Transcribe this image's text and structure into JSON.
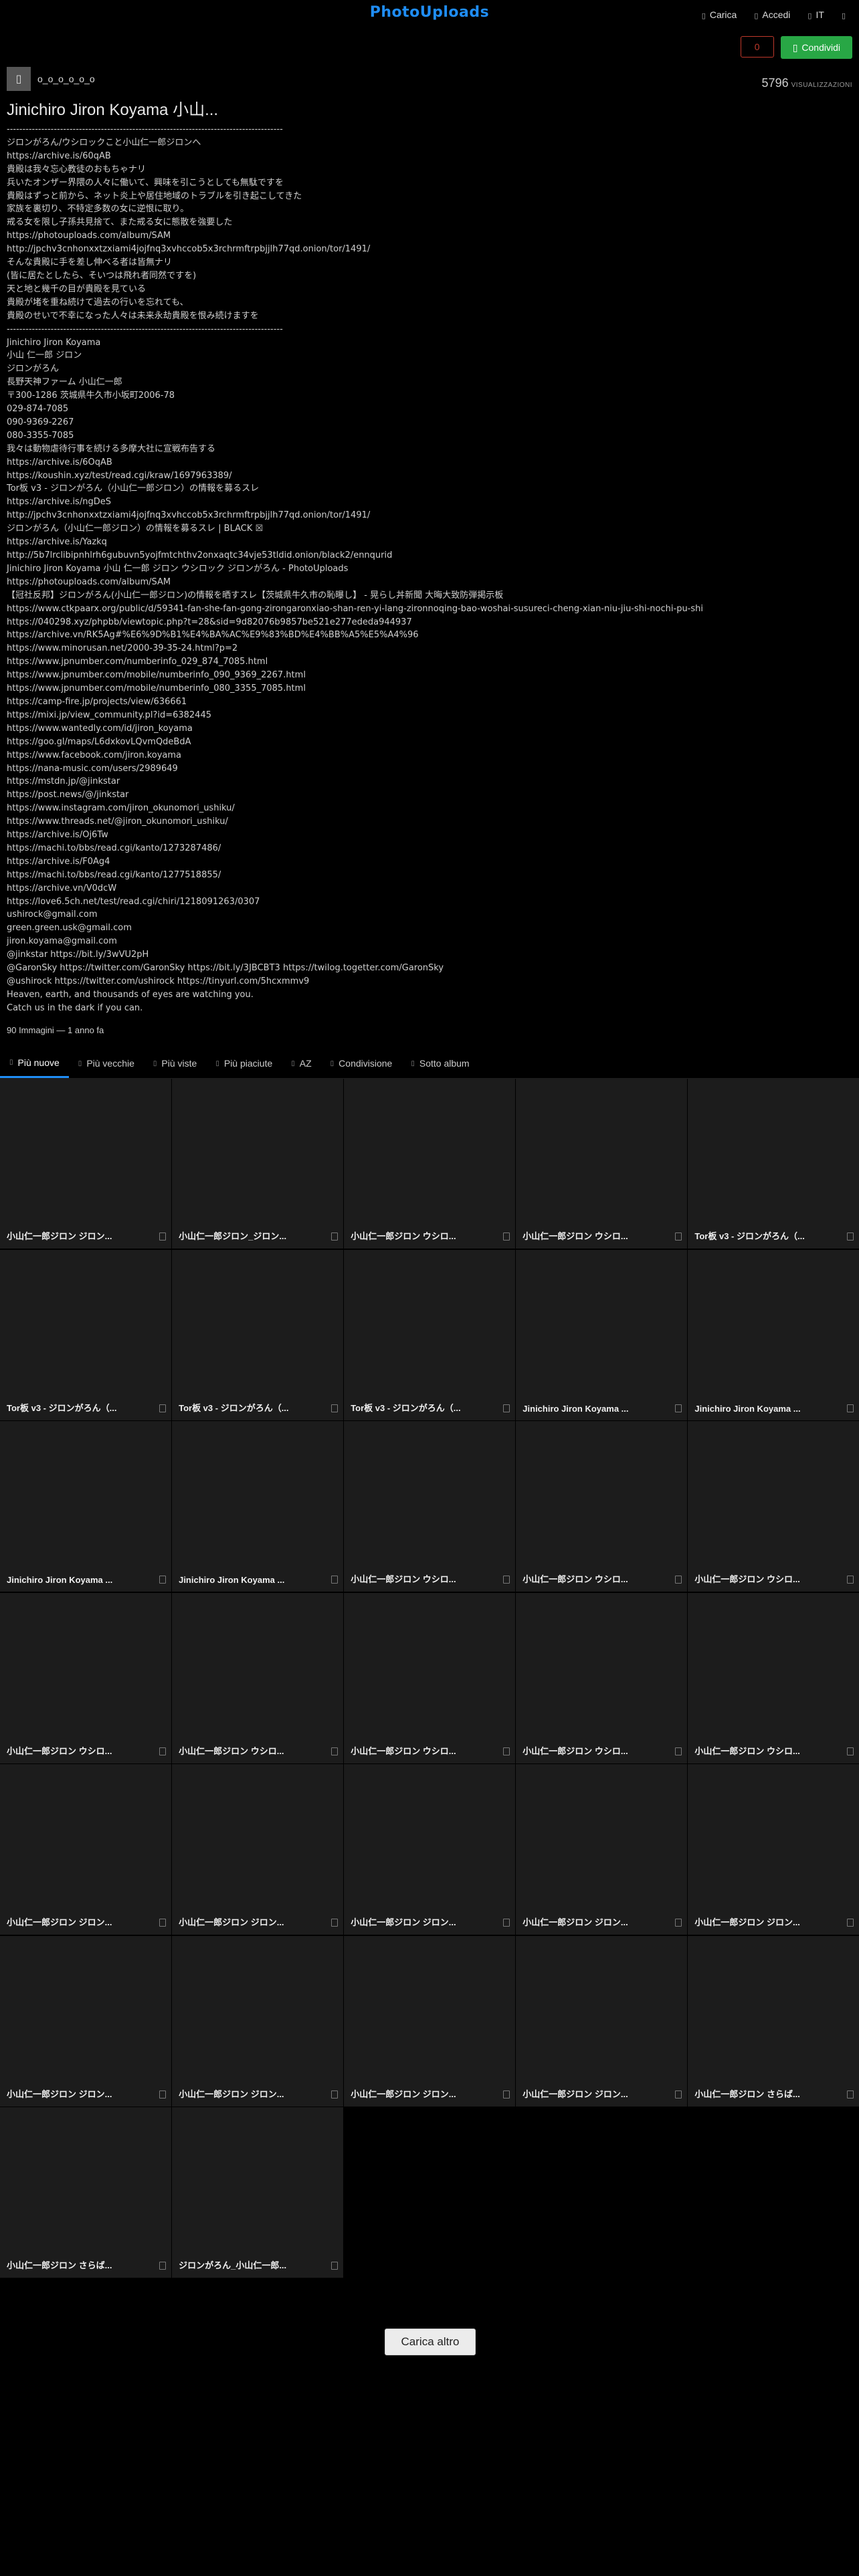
{
  "header": {
    "logo": "PhotoUploads",
    "nav": [
      {
        "label": "Carica",
        "icon": "upload-icon"
      },
      {
        "label": "Accedi",
        "icon": "login-icon"
      },
      {
        "label": "IT",
        "icon": "language-icon"
      },
      {
        "label": "",
        "icon": "menu-icon"
      }
    ]
  },
  "actions": {
    "like_count": "0",
    "share_label": "Condividi"
  },
  "owner": {
    "name": "o_o_o_o_o_o"
  },
  "views": {
    "count": "5796",
    "label": "VISUALIZZAZIONI"
  },
  "album": {
    "title": "Jinichiro Jiron Koyama 小山...",
    "description": "----------------------------------------------------------------------------------------\nジロンがろん/ウシロックこと小山仁一郎ジロンへ\nhttps://archive.is/60qAB\n貴殿は我々忘心教徒のおもちゃナリ\n兵いたオンザー界隈の人々に働いて、興味を引こうとしても無駄ですを\n貴殿はずっと前から、ネット炎上や居住地域のトラブルを引き起こしてきた\n家族を裏切り、不特定多数の女に逆恨に取り。\n戒る女を限し子孫共見捨て、また戒る女に態散を強要した\nhttps://photouploads.com/album/SAM\nhttp://jpchv3cnhonxxtzxiami4jojfnq3xvhccob5x3rchrmftrpbjjlh77qd.onion/tor/1491/\nそんな貴殿に手を差し伸べる者は皆無ナリ\n(皆に居たとしたら、そいつは飛れ者同然ですを)\n天と地と幾千の目が貴殿を見ている\n貴殿が堵を重ね続けて過去の行いを忘れても、\n貴殿のせいで不幸になった人々は未来永劫貴殿を恨み続けますを\n----------------------------------------------------------------------------------------\nJinichiro Jiron Koyama\n小山 仁一郎 ジロン\nジロンがろん\n長野天神ファーム 小山仁一郎\n〒300-1286 茨城県牛久市小坂町2006-78\n029-874-7085\n090-9369-2267\n080-3355-7085\n我々は動物虐待行事を続ける多摩大社に宣戦布告する\nhttps://archive.is/6OqAB\nhttps://koushin.xyz/test/read.cgi/kraw/1697963389/\nTor板 v3 - ジロンがろん（小山仁一郎ジロン）の情報を募るスレ\nhttps://archive.is/ngDeS\nhttp://jpchv3cnhonxxtzxiami4jojfnq3xvhccob5x3rchrmftrpbjjlh77qd.onion/tor/1491/\nジロンがろん（小山仁一郎ジロン）の情報を募るスレ | BLACK ☒\nhttps://archive.is/Yazkq\nhttp://5b7lrclibipnhlrh6gubuvn5yojfmtchthv2onxaqtc34vje53tldid.onion/black2/ennqurid\nJinichiro Jiron Koyama 小山 仁一郎 ジロン ウシロック ジロンがろん - PhotoUploads\nhttps://photouploads.com/album/SAM\n【冠社反邦】ジロンがろん(小山仁一郎ジロン)の情報を晒すスレ【茨城県牛久市の恥曝し】 - 晃らし丼新聞 大晦大致防弾掲示板\nhttps://www.ctkpaarx.org/public/d/59341-fan-she-fan-gong-zirongaronxiao-shan-ren-yi-lang-zironnoqing-bao-woshai-susureci-cheng-xian-niu-jiu-shi-nochi-pu-shi\nhttps://040298.xyz/phpbb/viewtopic.php?t=28&sid=9d82076b9857be521e277ededa944937\nhttps://archive.vn/RK5Ag#%E6%9D%B1%E4%BA%AC%E9%83%BD%E4%BB%A5%E5%A4%96\nhttps://www.minorusan.net/2000-39-35-24.html?p=2\nhttps://www.jpnumber.com/numberinfo_029_874_7085.html\nhttps://www.jpnumber.com/mobile/numberinfo_090_9369_2267.html\nhttps://www.jpnumber.com/mobile/numberinfo_080_3355_7085.html\nhttps://camp-fire.jp/projects/view/636661\nhttps://mixi.jp/view_community.pl?id=6382445\nhttps://www.wantedly.com/id/jiron_koyama\nhttps://goo.gl/maps/L6dxkovLQvmQdeBdA\nhttps://www.facebook.com/jiron.koyama\nhttps://nana-music.com/users/2989649\nhttps://mstdn.jp/@jinkstar\nhttps://post.news/@/jinkstar\nhttps://www.instagram.com/jiron_okunomori_ushiku/\nhttps://www.threads.net/@jiron_okunomori_ushiku/\nhttps://archive.is/Oj6Tw\nhttps://machi.to/bbs/read.cgi/kanto/1273287486/\nhttps://archive.is/F0Ag4\nhttps://machi.to/bbs/read.cgi/kanto/1277518855/\nhttps://archive.vn/V0dcW\nhttps://love6.5ch.net/test/read.cgi/chiri/1218091263/0307\nushirock@gmail.com\ngreen.green.usk@gmail.com\njiron.koyama@gmail.com\n@jinkstar https://bit.ly/3wVU2pH\n@GaronSky https://twitter.com/GaronSky https://bit.ly/3JBCBT3 https://twilog.togetter.com/GaronSky\n@ushirock https://twitter.com/ushirock https://tinyurl.com/5hcxmmv9\nHeaven, earth, and thousands of eyes are watching you.\nCatch us in the dark if you can.",
    "meta": "90 Immagini — 1 anno fa"
  },
  "tabs": [
    {
      "label": "Più nuove",
      "active": true
    },
    {
      "label": "Più vecchie",
      "active": false
    },
    {
      "label": "Più viste",
      "active": false
    },
    {
      "label": "Più piaciute",
      "active": false
    },
    {
      "label": "AZ",
      "active": false
    },
    {
      "label": "Condivisione",
      "active": false
    },
    {
      "label": "Sotto album",
      "active": false
    }
  ],
  "images": [
    "小山仁一郎ジロン ジロン...",
    "小山仁一郎ジロン_ジロン...",
    "小山仁一郎ジロン ウシロ...",
    "小山仁一郎ジロン ウシロ...",
    "Tor板 v3 - ジロンがろん（...",
    "Tor板 v3 - ジロンがろん（...",
    "Tor板 v3 - ジロンがろん（...",
    "Tor板 v3 - ジロンがろん（...",
    "Jinichiro Jiron Koyama ...",
    "Jinichiro Jiron Koyama ...",
    "Jinichiro Jiron Koyama ...",
    "Jinichiro Jiron Koyama ...",
    "小山仁一郎ジロン ウシロ...",
    "小山仁一郎ジロン ウシロ...",
    "小山仁一郎ジロン ウシロ...",
    "小山仁一郎ジロン ウシロ...",
    "小山仁一郎ジロン ウシロ...",
    "小山仁一郎ジロン ウシロ...",
    "小山仁一郎ジロン ウシロ...",
    "小山仁一郎ジロン ウシロ...",
    "小山仁一郎ジロン ジロン...",
    "小山仁一郎ジロン ジロン...",
    "小山仁一郎ジロン ジロン...",
    "小山仁一郎ジロン ジロン...",
    "小山仁一郎ジロン ジロン...",
    "小山仁一郎ジロン ジロン...",
    "小山仁一郎ジロン ジロン...",
    "小山仁一郎ジロン ジロン...",
    "小山仁一郎ジロン ジロン...",
    "小山仁一郎ジロン さらば...",
    "小山仁一郎ジロン さらば...",
    "ジロンがろん_小山仁一郎..."
  ],
  "load_more": "Carica altro"
}
